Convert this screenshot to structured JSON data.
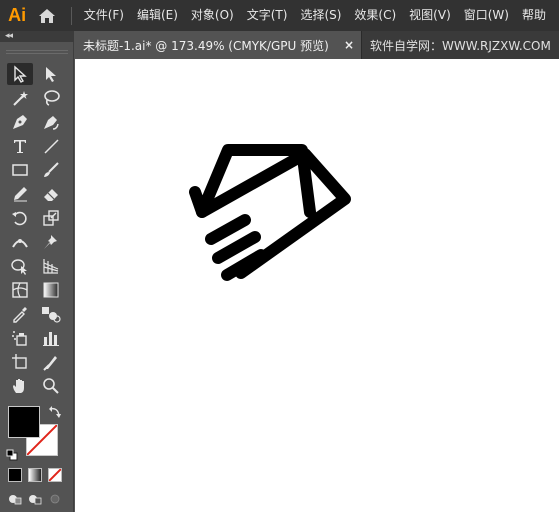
{
  "app": {
    "logo": "Ai"
  },
  "menu": {
    "items": [
      "文件(F)",
      "编辑(E)",
      "对象(O)",
      "文字(T)",
      "选择(S)",
      "效果(C)",
      "视图(V)",
      "窗口(W)",
      "帮助"
    ]
  },
  "tabs": {
    "active": {
      "label": "未标题-1.ai* @ 173.49% (CMYK/GPU 预览)",
      "close": "×"
    },
    "inactive": {
      "label": "软件自学网：WWW.RJZXW.COM"
    }
  },
  "panel": {
    "collapse": "◂◂"
  },
  "colors": {
    "fill": "#000000",
    "stroke": "none",
    "accent": "#ff9a00"
  }
}
